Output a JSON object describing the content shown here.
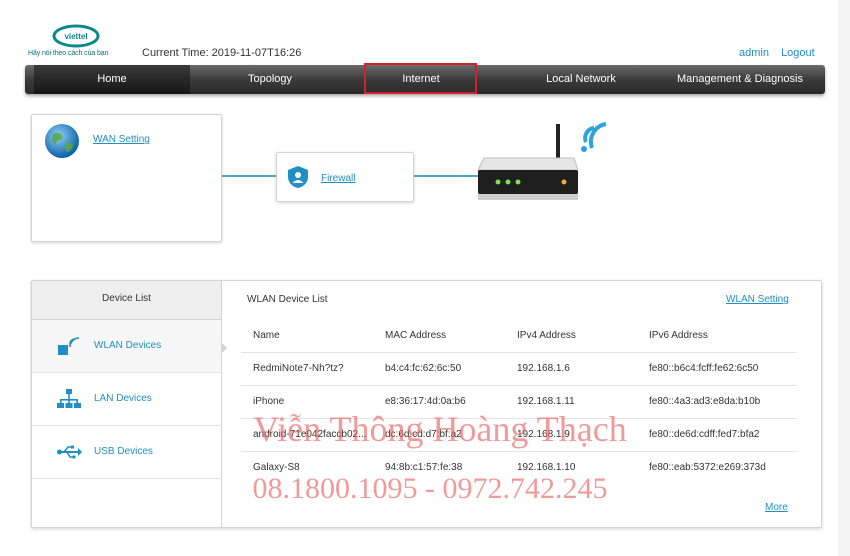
{
  "header": {
    "logo_name": "viettel-logo",
    "logo_text": "viettel",
    "tagline": "Hãy nói theo cách của bạn",
    "current_time_label": "Current Time: 2019-11-07T16:26",
    "user": "admin",
    "logout": "Logout"
  },
  "nav": {
    "items": [
      "Home",
      "Topology",
      "Internet",
      "Local Network",
      "Management & Diagnosis"
    ],
    "active": "Home",
    "highlighted": "Internet"
  },
  "topology": {
    "wan_setting": "WAN Setting",
    "firewall": "Firewall",
    "icons": [
      "globe-icon",
      "shield-icon",
      "router-icon",
      "wifi-signal-icon"
    ]
  },
  "devices": {
    "side_header": "Device List",
    "side_items": [
      {
        "label": "WLAN Devices",
        "icon": "wlan-devices-icon"
      },
      {
        "label": "LAN Devices",
        "icon": "lan-devices-icon"
      },
      {
        "label": "USB Devices",
        "icon": "usb-icon"
      }
    ],
    "list_title": "WLAN Device List",
    "wlan_setting_link": "WLAN Setting",
    "columns": [
      "Name",
      "MAC Address",
      "IPv4 Address",
      "IPv6 Address"
    ],
    "rows": [
      [
        "RedmiNote7-Nh?tz?",
        "b4:c4:fc:62:6c:50",
        "192.168.1.6",
        "fe80::b6c4:fcff:fe62:6c50"
      ],
      [
        "iPhone",
        "e8:36:17:4d:0a:b6",
        "192.168.1.11",
        "fe80::4a3:ad3:e8da:b10b"
      ],
      [
        "android-71e042faccb02...",
        "dc:6d:cd:d7:bf:a2",
        "192.168.1.9",
        "fe80::de6d:cdff:fed7:bfa2"
      ],
      [
        "Galaxy-S8",
        "94:8b:c1:57:fe:38",
        "192.168.1.10",
        "fe80::eab:5372:e269:373d"
      ]
    ],
    "more": "More"
  },
  "watermark": {
    "line1": "Viễn Thông Hoàng Thạch",
    "line2": "08.1800.1095 - 0972.742.245"
  },
  "colors": {
    "link": "#1f8fc4",
    "highlight": "#d4202a",
    "navbar": "#3a3a3a",
    "watermark": "#e85c5c"
  }
}
